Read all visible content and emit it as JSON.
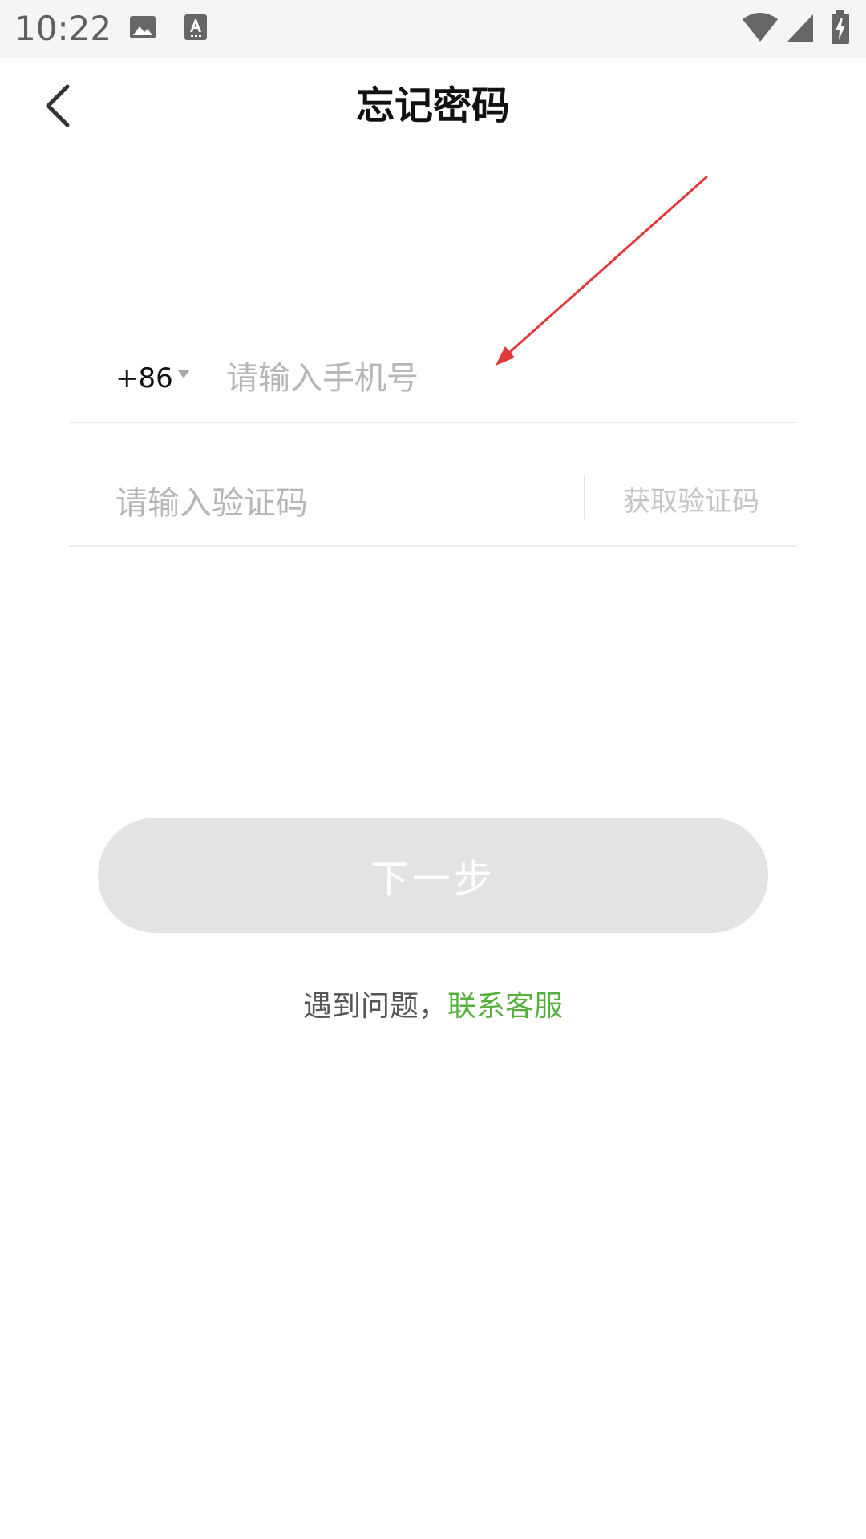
{
  "status_bar": {
    "time": "10:22",
    "icons": [
      "gallery-icon",
      "text-recognition-icon",
      "wifi-icon",
      "cell-signal-icon",
      "battery-charging-icon"
    ]
  },
  "header": {
    "title": "忘记密码",
    "back_icon": "chevron-left-icon"
  },
  "form": {
    "country_code": "+86",
    "phone_placeholder": "请输入手机号",
    "code_placeholder": "请输入验证码",
    "get_code_label": "获取验证码"
  },
  "actions": {
    "next_label": "下一步"
  },
  "help": {
    "text": "遇到问题，",
    "contact_label": "联系客服"
  },
  "colors": {
    "accent_green": "#55b03c",
    "annotation_red": "#e03a3a",
    "disabled_button": "#e3e3e3"
  }
}
